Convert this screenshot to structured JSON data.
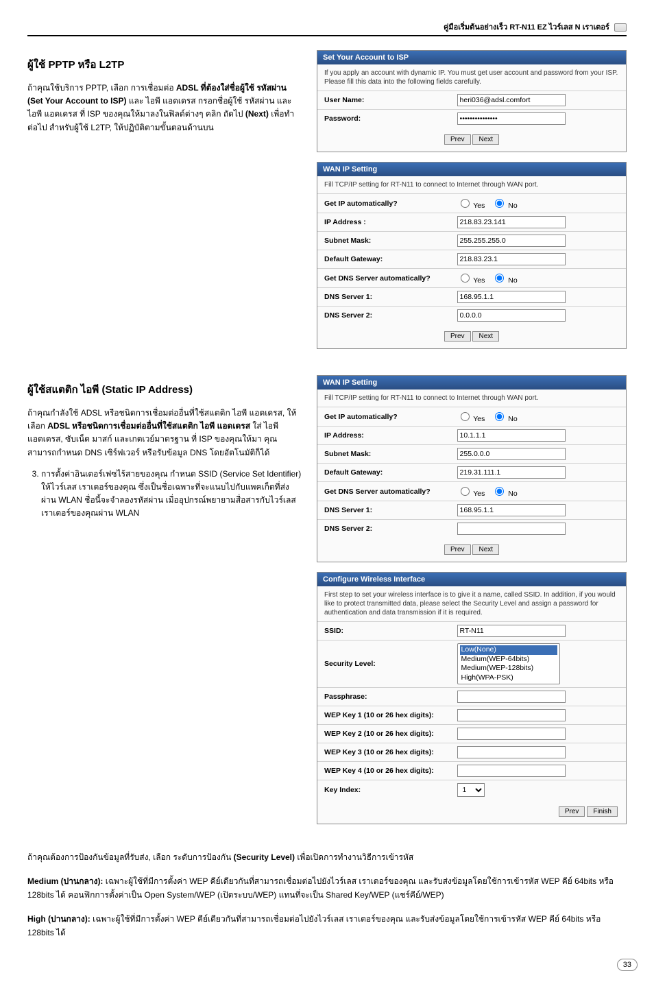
{
  "header": {
    "title": "คู่มือเริ่มต้นอย่างเร็ว RT-N11 EZ ไวร์เลส N เราเตอร์"
  },
  "section1": {
    "title": "ผู้ใช้ PPTP หรือ L2TP",
    "paragraph": "ถ้าคุณใช้บริการ PPTP, เลือก การเชื่อมต่อ ADSL ที่ต้องใส่ชื่อผู้ใช้ รหัสผ่าน (Set Your Account to ISP) และ ไอพี แอดเดรส กรอกชื่อผู้ใช้ รหัสผ่าน และ ไอพี แอดเดรส ที่ ISP ของคุณให้มาลงในฟิลด์ต่างๆ คลิก ถัดไป (Next) เพื่อทำต่อไป สำหรับผู้ใช้ L2TP, ให้ปฏิบัติตามขั้นตอนด้านบน"
  },
  "panel_account": {
    "title": "Set Your Account to ISP",
    "desc": "If you apply an account with dynamic IP. You must get user account and password from your ISP. Please fill this data into the following fields carefully.",
    "user_label": "User Name:",
    "user_value": "heri036@adsl.comfort",
    "pass_label": "Password:",
    "pass_value": "***************",
    "prev": "Prev",
    "next": "Next"
  },
  "panel_wan1": {
    "title": "WAN IP Setting",
    "desc": "Fill TCP/IP setting for RT-N11 to connect to Internet through WAN port.",
    "rows": [
      {
        "label": "Get IP automatically?",
        "type": "radio",
        "yes": "Yes",
        "no": "No",
        "selected": "no"
      },
      {
        "label": "IP Address :",
        "type": "text",
        "value": "218.83.23.141"
      },
      {
        "label": "Subnet Mask:",
        "type": "text",
        "value": "255.255.255.0"
      },
      {
        "label": "Default Gateway:",
        "type": "text",
        "value": "218.83.23.1"
      },
      {
        "label": "Get DNS Server automatically?",
        "type": "radio",
        "yes": "Yes",
        "no": "No",
        "selected": "no"
      },
      {
        "label": "DNS Server 1:",
        "type": "text",
        "value": "168.95.1.1"
      },
      {
        "label": "DNS Server 2:",
        "type": "text",
        "value": "0.0.0.0"
      }
    ],
    "prev": "Prev",
    "next": "Next"
  },
  "section2": {
    "title": "ผู้ใช้สแตติก ไอพี (Static IP Address)",
    "paragraph": "ถ้าคุณกำลังใช้ ADSL หรือชนิดการเชื่อมต่ออื่นที่ใช้สแตติก ไอพี แอดเดรส, ให้เลือก ADSL หรือชนิดการเชื่อมต่ออื่นที่ใช้สแตติก ไอพี แอดเดรส ใส่ ไอพี แอดเดรส, ซับเน็ต มาสก์ และเกตเวย์มาตรฐาน ที่ ISP ของคุณให้มา คุณสามารถกำหนด DNS เซิร์ฟเวอร์ หรือรับข้อมูล DNS โดยอัตโนมัติก็ได้",
    "step3": "การตั้งค่าอินเตอร์เฟซไร้สายของคุณ กำหนด SSID (Service Set Identifier) ให้ไวร์เลส เราเตอร์ของคุณ ซึ่งเป็นชื่อเฉพาะที่จะแนบไปกับแพคเก็ตที่ส่งผ่าน WLAN ชื่อนี้จะจำลองรหัสผ่าน เมื่ออุปกรณ์พยายามสื่อสารกับไวร์เลส เราเตอร์ของคุณผ่าน WLAN"
  },
  "panel_wan2": {
    "title": "WAN IP Setting",
    "desc": "Fill TCP/IP setting for RT-N11 to connect to Internet through WAN port.",
    "rows": [
      {
        "label": "Get IP automatically?",
        "type": "radio",
        "yes": "Yes",
        "no": "No",
        "selected": "no"
      },
      {
        "label": "IP Address:",
        "type": "text",
        "value": "10.1.1.1"
      },
      {
        "label": "Subnet Mask:",
        "type": "text",
        "value": "255.0.0.0"
      },
      {
        "label": "Default Gateway:",
        "type": "text",
        "value": "219.31.111.1"
      },
      {
        "label": "Get DNS Server automatically?",
        "type": "radio",
        "yes": "Yes",
        "no": "No",
        "selected": "no"
      },
      {
        "label": "DNS Server 1:",
        "type": "text",
        "value": "168.95.1.1"
      },
      {
        "label": "DNS Server 2:",
        "type": "text",
        "value": ""
      }
    ],
    "prev": "Prev",
    "next": "Next"
  },
  "panel_wireless": {
    "title": "Configure Wireless Interface",
    "desc": "First step to set your wireless interface is to give it a name, called SSID. In addition, if you would like to protect transmitted data, please select the Security Level and assign a password for authentication and data transmission if it is required.",
    "rows": [
      {
        "label": "SSID:",
        "type": "text",
        "value": "RT-N11"
      },
      {
        "label": "Security Level:",
        "type": "select",
        "value": "Low(None)",
        "options": [
          "Low(None)",
          "Medium(WEP-64bits)",
          "Medium(WEP-128bits)",
          "High(WPA-PSK)"
        ]
      },
      {
        "label": "Passphrase:",
        "type": "text",
        "value": ""
      },
      {
        "label": "WEP Key 1 (10 or 26 hex digits):",
        "type": "text",
        "value": ""
      },
      {
        "label": "WEP Key 2 (10 or 26 hex digits):",
        "type": "text",
        "value": ""
      },
      {
        "label": "WEP Key 3 (10 or 26 hex digits):",
        "type": "text",
        "value": ""
      },
      {
        "label": "WEP Key 4 (10 or 26 hex digits):",
        "type": "text",
        "value": ""
      },
      {
        "label": "Key Index:",
        "type": "select_small",
        "value": "1"
      }
    ],
    "prev": "Prev",
    "finish": "Finish"
  },
  "bottom": {
    "p1": "ถ้าคุณต้องการป้องกันข้อมูลที่รับส่ง, เลือก ระดับการป้องกัน (Security Level) เพื่อเปิดการทำงานวิธีการเข้ารหัส",
    "p2_label": "Medium (ปานกลาง):",
    "p2_text": " เฉพาะผู้ใช้ที่มีการตั้งค่า WEP คีย์เดียวกันที่สามารถเชื่อมต่อไปยังไวร์เลส เราเตอร์ของคุณ และรับส่งข้อมูลโดยใช้การเข้ารหัส WEP คีย์ 64bits หรือ 128bits ได้ คอนฟิกการตั้งค่าเป็น Open System/WEP (เปิดระบบ/WEP) แทนที่จะเป็น Shared Key/WEP (แชร์คีย์/WEP)",
    "p3_label": "High (ปานกลาง):",
    "p3_text": " เฉพาะผู้ใช้ที่มีการตั้งค่า WEP คีย์เดียวกันที่สามารถเชื่อมต่อไปยังไวร์เลส เราเตอร์ของคุณ และรับส่งข้อมูลโดยใช้การเข้ารหัส WEP คีย์ 64bits หรือ 128bits ได้"
  },
  "page_number": "33"
}
